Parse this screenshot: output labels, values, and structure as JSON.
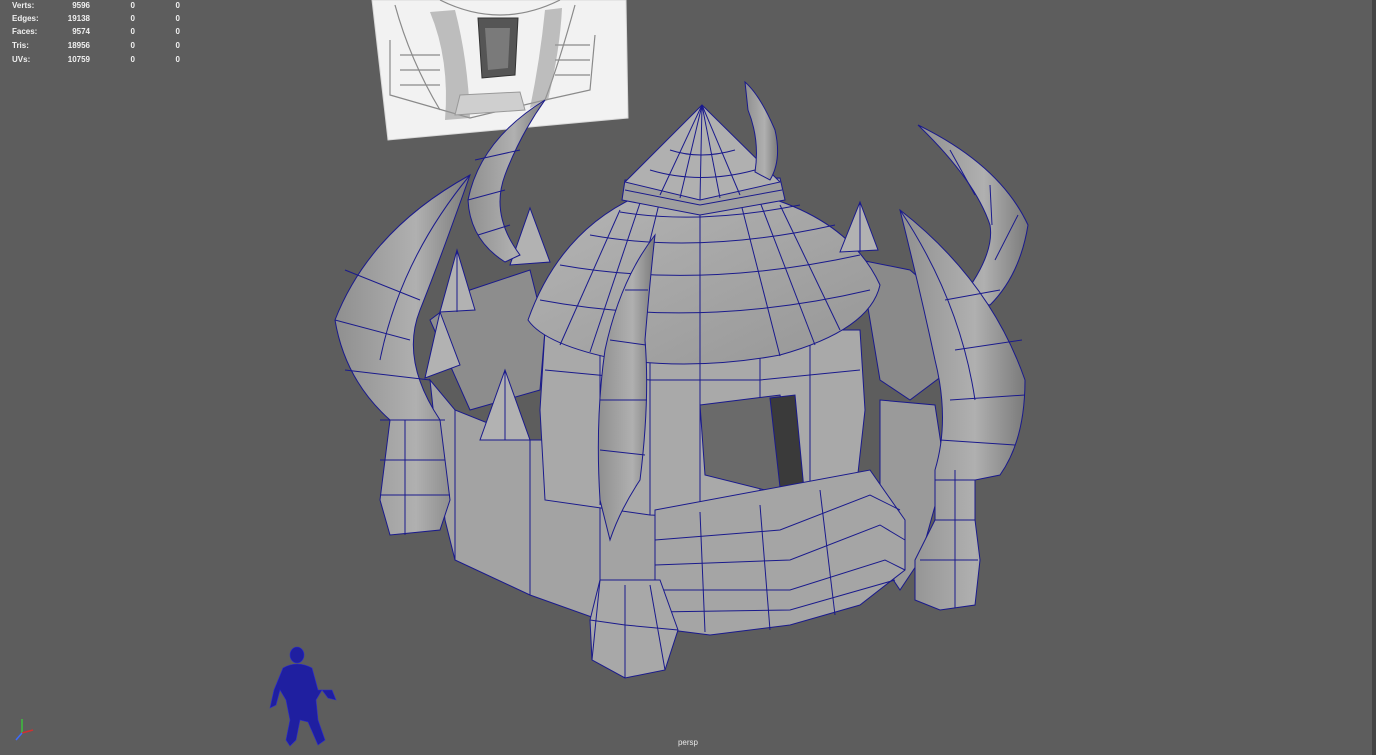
{
  "hud": {
    "rows": [
      {
        "label": "Verts:",
        "v1": "9596",
        "v2": "0",
        "v3": "0"
      },
      {
        "label": "Edges:",
        "v1": "19138",
        "v2": "0",
        "v3": "0"
      },
      {
        "label": "Faces:",
        "v1": "9574",
        "v2": "0",
        "v3": "0"
      },
      {
        "label": "Tris:",
        "v1": "18956",
        "v2": "0",
        "v3": "0"
      },
      {
        "label": "UVs:",
        "v1": "10759",
        "v2": "0",
        "v3": "0"
      }
    ]
  },
  "camera": {
    "label": "persp"
  },
  "colors": {
    "background": "#5d5d5d",
    "wireframe": "#1a1a8c",
    "mesh_face": "#a6a6a6",
    "figure": "#1f1fa0"
  },
  "icons": {
    "axis_gizmo": "axis-gizmo-icon"
  }
}
